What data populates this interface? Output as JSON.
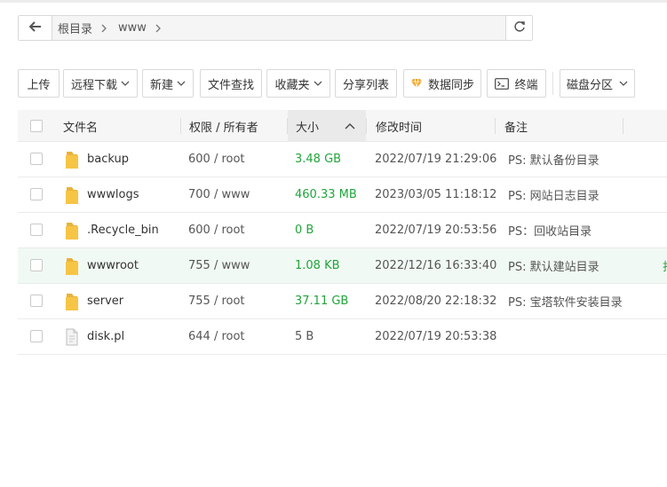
{
  "path": {
    "root_label": "根目录",
    "segments": [
      "www"
    ]
  },
  "toolbar": {
    "upload": "上传",
    "remote_download": "远程下载",
    "new": "新建",
    "file_search": "文件查找",
    "favorites": "收藏夹",
    "share_list": "分享列表",
    "data_sync": "数据同步",
    "terminal": "终端",
    "disk_partition": "磁盘分区"
  },
  "table": {
    "headers": {
      "name": "文件名",
      "permission": "权限 / 所有者",
      "size": "大小",
      "modified": "修改时间",
      "remark": "备注"
    },
    "size_sort_direction": "ascending",
    "rows": [
      {
        "type": "folder",
        "name": "backup",
        "perm": "600 / root",
        "size": "3.48 GB",
        "size_color": "green",
        "modified": "2022/07/19 21:29:06",
        "remark": "PS: 默认备份目录",
        "highlighted": false
      },
      {
        "type": "folder",
        "name": "wwwlogs",
        "perm": "700 / www",
        "size": "460.33 MB",
        "size_color": "green",
        "modified": "2023/03/05 11:18:12",
        "remark": "PS: 网站日志目录",
        "highlighted": false
      },
      {
        "type": "folder",
        "name": ".Recycle_bin",
        "perm": "600 / root",
        "size": "0 B",
        "size_color": "green",
        "modified": "2022/07/19 20:53:56",
        "remark": "PS：回收站目录",
        "highlighted": false
      },
      {
        "type": "folder",
        "name": "wwwroot",
        "perm": "755 / www",
        "size": "1.08 KB",
        "size_color": "green",
        "modified": "2022/12/16 16:33:40",
        "remark": "PS: 默认建站目录",
        "highlighted": true,
        "edge_text": "打"
      },
      {
        "type": "folder",
        "name": "server",
        "perm": "755 / root",
        "size": "37.11 GB",
        "size_color": "green",
        "modified": "2022/08/20 22:18:32",
        "remark": "PS: 宝塔软件安装目录",
        "highlighted": false
      },
      {
        "type": "file",
        "name": "disk.pl",
        "perm": "644 / root",
        "size": "5 B",
        "size_color": "default",
        "modified": "2022/07/19 20:53:38",
        "remark": "",
        "highlighted": false
      }
    ]
  },
  "colors": {
    "accent_green": "#20a53a",
    "folder_yellow": "#f7c545",
    "row_highlight": "#f1f9f4"
  },
  "icons": {
    "back": "arrow-left-icon",
    "refresh": "refresh-icon",
    "breadcrumb_separator": "chevron-right-icon",
    "dropdown": "chevron-down-icon",
    "sync": "gem-icon",
    "terminal": "terminal-icon",
    "folder": "folder-icon",
    "file": "file-icon",
    "sort": "chevron-up-icon"
  }
}
